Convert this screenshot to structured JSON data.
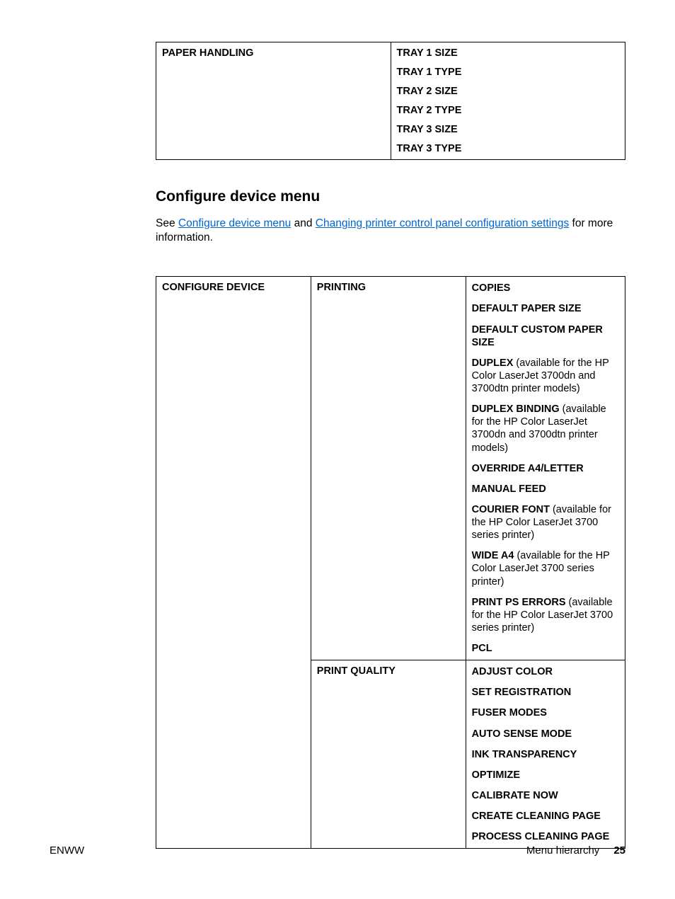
{
  "table1": {
    "header": "PAPER HANDLING",
    "items": [
      "TRAY 1 SIZE",
      "TRAY 1 TYPE",
      "TRAY 2 SIZE",
      "TRAY 2 TYPE",
      "TRAY 3 SIZE",
      "TRAY 3 TYPE"
    ]
  },
  "section": {
    "heading": "Configure device menu",
    "intro_prefix": "See ",
    "link1": "Configure device menu",
    "intro_mid": " and ",
    "link2": "Changing printer control panel configuration settings",
    "intro_suffix": " for more information."
  },
  "table2": {
    "col1": "CONFIGURE DEVICE",
    "row1": {
      "col2": "PRINTING",
      "items": [
        {
          "bold": "COPIES",
          "rest": ""
        },
        {
          "bold": "DEFAULT PAPER SIZE",
          "rest": ""
        },
        {
          "bold": "DEFAULT CUSTOM PAPER SIZE",
          "rest": ""
        },
        {
          "bold": "DUPLEX",
          "rest": " (available for the HP Color LaserJet 3700dn and 3700dtn printer models)"
        },
        {
          "bold": "DUPLEX BINDING",
          "rest": " (available for the HP Color LaserJet 3700dn and 3700dtn printer models)"
        },
        {
          "bold": "OVERRIDE A4/LETTER",
          "rest": ""
        },
        {
          "bold": "MANUAL FEED",
          "rest": ""
        },
        {
          "bold": "COURIER FONT",
          "rest": " (available for the HP Color LaserJet 3700 series printer)"
        },
        {
          "bold": "WIDE A4",
          "rest": " (available for the HP Color LaserJet 3700 series printer)"
        },
        {
          "bold": "PRINT PS ERRORS",
          "rest": " (available for the HP Color LaserJet 3700 series printer)"
        },
        {
          "bold": "PCL",
          "rest": ""
        }
      ]
    },
    "row2": {
      "col2": "PRINT QUALITY",
      "items": [
        {
          "bold": "ADJUST COLOR",
          "rest": ""
        },
        {
          "bold": "SET REGISTRATION",
          "rest": ""
        },
        {
          "bold": "FUSER MODES",
          "rest": ""
        },
        {
          "bold": "AUTO SENSE MODE",
          "rest": ""
        },
        {
          "bold": "INK TRANSPARENCY",
          "rest": ""
        },
        {
          "bold": "OPTIMIZE",
          "rest": ""
        },
        {
          "bold": "CALIBRATE NOW",
          "rest": ""
        },
        {
          "bold": "CREATE CLEANING PAGE",
          "rest": ""
        },
        {
          "bold": "PROCESS CLEANING PAGE",
          "rest": ""
        }
      ]
    }
  },
  "footer": {
    "left": "ENWW",
    "right_label": "Menu hierarchy",
    "page": "25"
  }
}
